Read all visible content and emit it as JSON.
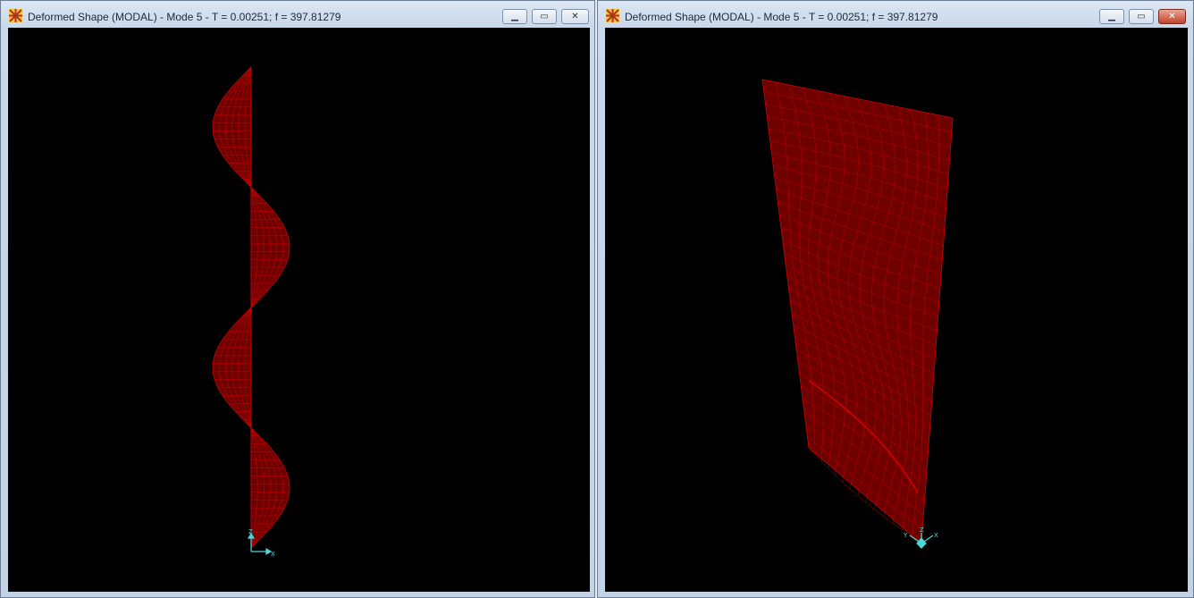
{
  "windows": [
    {
      "title": "Deformed Shape (MODAL) - Mode 5 - T = 0.00251;  f = 397.81279",
      "controls": {
        "minimize": "▁",
        "maximize": "▭",
        "close": "✕"
      },
      "view": "elevation-xz",
      "axes": {
        "z": "Z",
        "x": "X"
      }
    },
    {
      "title": "Deformed Shape (MODAL) - Mode 5 - T = 0.00251;  f = 397.81279",
      "controls": {
        "minimize": "▁",
        "maximize": "▭",
        "close": "✕"
      },
      "view": "3d",
      "axes": {
        "y": "Y",
        "z": "Z",
        "x": "X"
      }
    }
  ],
  "colors": {
    "mesh_fill": "#6e0000",
    "mesh_line": "#c80000",
    "axis": "#4fd6d6",
    "viewport_bg": "#000000"
  },
  "icons": {
    "app": "sap2000-app-icon",
    "minimize": "minimize-icon",
    "maximize": "maximize-icon",
    "close": "close-icon"
  }
}
